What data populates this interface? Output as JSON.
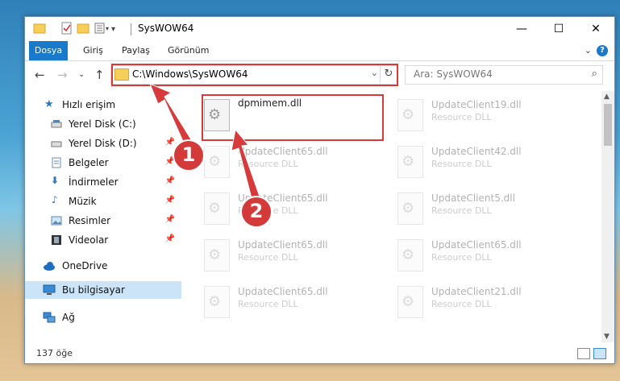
{
  "window": {
    "title": "SysWOW64",
    "controls": {
      "minimize": "—",
      "maximize": "☐",
      "close": "✕"
    }
  },
  "ribbon": {
    "tabs": [
      "Dosya",
      "Giriş",
      "Paylaş",
      "Görünüm"
    ],
    "help": "?"
  },
  "nav": {
    "address": "C:\\Windows\\SysWOW64",
    "search_placeholder": "Ara: SysWOW64"
  },
  "sidebar": {
    "quick_access": "Hızlı erişim",
    "items": [
      {
        "label": "Yerel Disk (C:)",
        "icon": "drive-icon",
        "pinned": false
      },
      {
        "label": "Yerel Disk (D:)",
        "icon": "drive-icon",
        "pinned": true
      },
      {
        "label": "Belgeler",
        "icon": "documents-icon",
        "pinned": true
      },
      {
        "label": "İndirmeler",
        "icon": "downloads-icon",
        "pinned": true
      },
      {
        "label": "Müzik",
        "icon": "music-icon",
        "pinned": true
      },
      {
        "label": "Resimler",
        "icon": "pictures-icon",
        "pinned": true
      },
      {
        "label": "Videolar",
        "icon": "videos-icon",
        "pinned": true
      }
    ],
    "onedrive": "OneDrive",
    "this_pc": "Bu bilgisayar",
    "network": "Ağ"
  },
  "files": [
    {
      "name": "dpmimem.dll",
      "type": ""
    },
    {
      "name": "UpdateClient19.dll",
      "type": "Resource DLL"
    },
    {
      "name": "UpdateClient65.dll",
      "type": "Resource DLL"
    },
    {
      "name": "UpdateClient42.dll",
      "type": "Resource DLL"
    },
    {
      "name": "UpdateClient65.dll",
      "type": "Resource DLL"
    },
    {
      "name": "UpdateClient5.dll",
      "type": "Resource DLL"
    },
    {
      "name": "UpdateClient65.dll",
      "type": "Resource DLL"
    },
    {
      "name": "UpdateClient65.dll",
      "type": "Resource DLL"
    },
    {
      "name": "UpdateClient65.dll",
      "type": "Resource DLL"
    },
    {
      "name": "UpdateClient21.dll",
      "type": "Resource DLL"
    }
  ],
  "status": {
    "count": "137 öğe"
  },
  "annotations": {
    "step1": "1",
    "step2": "2",
    "color": "#d63a3a"
  }
}
